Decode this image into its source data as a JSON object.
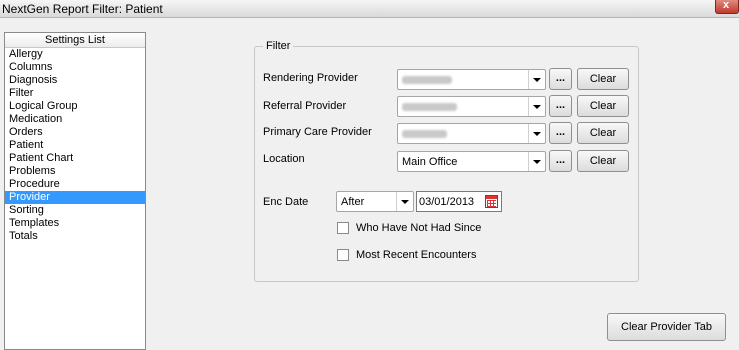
{
  "window": {
    "title": "NextGen Report Filter: Patient",
    "close_label": "x"
  },
  "settings": {
    "header": "Settings List",
    "items": [
      "Allergy",
      "Columns",
      "Diagnosis",
      "Filter",
      "Logical Group",
      "Medication",
      "Orders",
      "Patient",
      "Patient Chart",
      "Problems",
      "Procedure",
      "Provider",
      "Sorting",
      "Templates",
      "Totals"
    ],
    "selected": "Provider"
  },
  "filter": {
    "legend": "Filter",
    "rows": [
      {
        "label": "Rendering Provider",
        "value": "",
        "ellipsis": "...",
        "clear": "Clear"
      },
      {
        "label": "Referral Provider",
        "value": "",
        "ellipsis": "...",
        "clear": "Clear"
      },
      {
        "label": "Primary Care Provider",
        "value": "",
        "ellipsis": "...",
        "clear": "Clear"
      },
      {
        "label": "Location",
        "value": "Main Office",
        "ellipsis": "...",
        "clear": "Clear"
      }
    ],
    "enc_date": {
      "label": "Enc Date",
      "operator": "After",
      "date": "03/01/2013"
    },
    "checkboxes": [
      {
        "label": "Who Have Not Had Since",
        "checked": false
      },
      {
        "label": "Most Recent Encounters",
        "checked": false
      }
    ]
  },
  "footer": {
    "clear_tab_label": "Clear Provider Tab"
  }
}
